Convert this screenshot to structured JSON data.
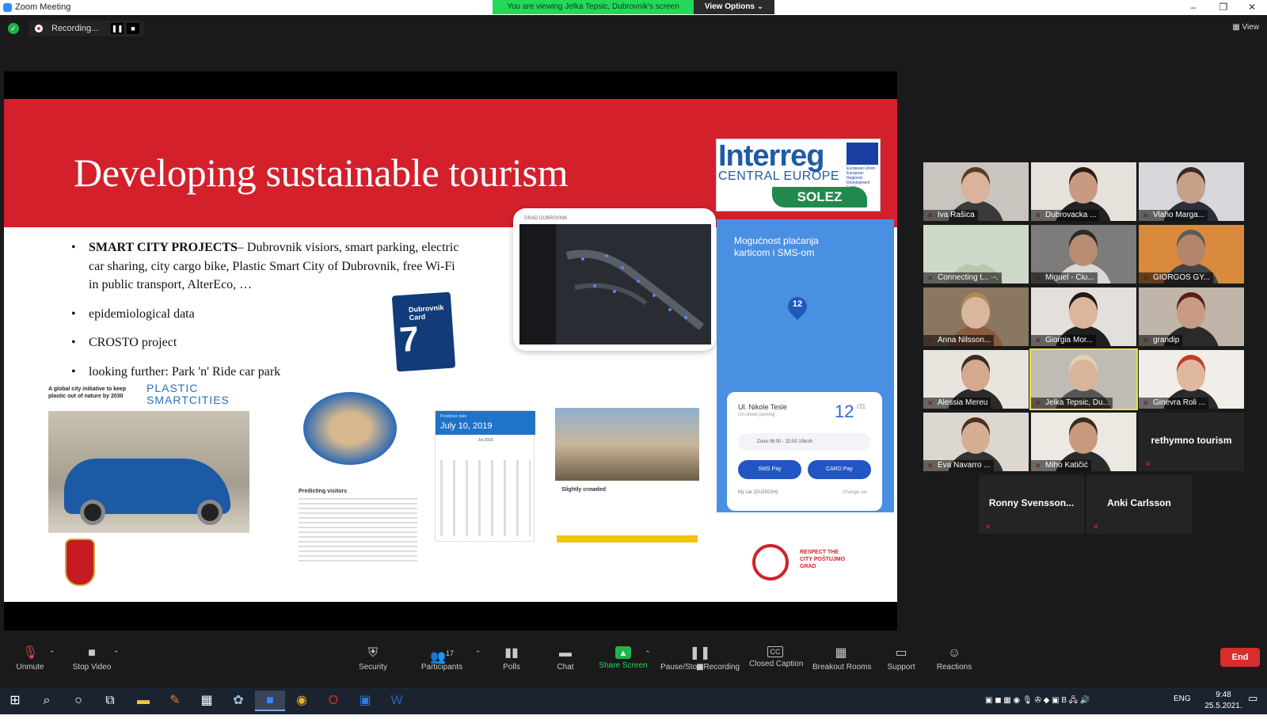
{
  "window": {
    "title": "Zoom Meeting",
    "share_banner": "You are viewing Jelka Tepsic, Dubrovnik's screen",
    "view_options": "View Options ⌄",
    "minimize": "–",
    "restore": "❐",
    "close": "✕"
  },
  "topbar": {
    "recording": "Recording...",
    "pause": "❚❚",
    "stop": "■",
    "view": "View"
  },
  "slide": {
    "title": "Developing sustainable tourism",
    "interreg_big": "Interreg",
    "interreg_ce": "CENTRAL EUROPE",
    "eu_text": "European Union European Regional Development Fund",
    "solez": "SOLEZ",
    "bullets": [
      {
        "bold": "SMART CITY PROJECTS",
        "text": "– Dubrovnik visiors, smart parking, electric car sharing, city cargo bike, Plastic Smart City of Dubrovnik, free Wi-Fi in public transport,  AlterEco, …"
      },
      {
        "bold": "",
        "text": "epidemiological data"
      },
      {
        "bold": "",
        "text": "CROSTO project"
      },
      {
        "bold": "",
        "text": "looking further: Park 'n' Ride car park"
      }
    ],
    "map_label": "GRAD DUBROVNIK",
    "phone_title": "Mogućnost plaćanja karticom i SMS-om",
    "pin_number": "12",
    "street": "Ul. Nikole Tesle",
    "street_sub": "On-street parking",
    "spaces": "12",
    "spaces_total": "/31",
    "zone": "Zone      06:00 - 22:00      10kn/h",
    "sms_pay": "SMS Pay",
    "card_pay": "CARD Pay",
    "my_car": "My car  (DU555SH)",
    "change_car": "Change car",
    "plastic_left": "A global city initiative to keep plastic out of nature by 2030",
    "plastic_right_1": "PLASTIC",
    "plastic_right_2": "SMARTCITIES",
    "dub_card_title": "Dubrovnik Card",
    "dub_card_num": "7",
    "visitors_title": "Predicting visitors",
    "calendar_small": "Prediction date",
    "calendar_date": "July 10, 2019",
    "calendar_month": "Jul 2019",
    "crowded": "Slightly crowded",
    "respect": "RESPECT THE CITY POŠTUJMO GRAD"
  },
  "participants": [
    {
      "name": "Iva Rašica",
      "bg": "#c9c4bd",
      "skin": "#d9b39a",
      "shirt": "#3a3a3a",
      "hair": "#5a3b28"
    },
    {
      "name": "Dubrovacka ...",
      "bg": "#e6e1da",
      "skin": "#c89a82",
      "shirt": "#222",
      "hair": "#2a1d15"
    },
    {
      "name": "Vlaho Marga...",
      "bg": "#d6d8dc",
      "skin": "#c7a089",
      "shirt": "#2b2f3a",
      "hair": "#3a2a20"
    },
    {
      "name": "Connecting t... ·-.",
      "bg": "#cfd9c8",
      "skin": "#cfd9c8",
      "shirt": "#b8c6ad",
      "hair": "#cfd9c8"
    },
    {
      "name": "Miguel - Ciu...",
      "bg": "#7d7c7a",
      "skin": "#b88d72",
      "shirt": "#d8d8d8",
      "hair": "#2a2a2a"
    },
    {
      "name": "GIORGOS GY...",
      "bg": "#d98a3c",
      "skin": "#b4856a",
      "shirt": "#444",
      "hair": "#5a5a5a"
    },
    {
      "name": "Anna Nilsson...",
      "bg": "#8a7760",
      "skin": "#d9b79e",
      "shirt": "#8a5a3a",
      "hair": "#b08858"
    },
    {
      "name": "Giorgia Mor...",
      "bg": "#e3e0db",
      "skin": "#dcb59c",
      "shirt": "#1f1f1f",
      "hair": "#1f1a17"
    },
    {
      "name": "grandip",
      "bg": "#bfb5a8",
      "skin": "#c99a84",
      "shirt": "#2a2a2a",
      "hair": "#5a1c14"
    },
    {
      "name": "Alessia Mereu",
      "bg": "#e8e4de",
      "skin": "#d4a98e",
      "shirt": "#2a2a2a",
      "hair": "#3a2a1e"
    },
    {
      "name": "Jelka Tepsic, Du...",
      "bg": "#bfbcb6",
      "skin": "#d9b49c",
      "shirt": "#555",
      "hair": "#e2d3b0"
    },
    {
      "name": "Ginevra Roli ...",
      "bg": "#f1ede8",
      "skin": "#e0b8a0",
      "shirt": "#2b2b2b",
      "hair": "#c23b22"
    },
    {
      "name": "Eva Navarro ...",
      "bg": "#dcd7cf",
      "skin": "#d6ae94",
      "shirt": "#333",
      "hair": "#4a3020"
    },
    {
      "name": "Miho Katičić",
      "bg": "#ece8e2",
      "skin": "#c9997e",
      "shirt": "#2a2a2a",
      "hair": "#3a2a20"
    }
  ],
  "nocam_participants": [
    {
      "name": "rethymno tourism"
    },
    {
      "name": "Ronny  Svensson..."
    },
    {
      "name": "Anki Carlsson"
    }
  ],
  "toolbar": {
    "unmute": "Unmute",
    "stop_video": "Stop Video",
    "security": "Security",
    "participants": "Participants",
    "participants_count": "17",
    "polls": "Polls",
    "chat": "Chat",
    "share_screen": "Share Screen",
    "pause_stop_recording": "Pause/Stop Recording",
    "closed_caption": "Closed Caption",
    "breakout_rooms": "Breakout Rooms",
    "support": "Support",
    "reactions": "Reactions",
    "end": "End"
  },
  "taskbar": {
    "language": "ENG",
    "time": "9:48",
    "date": "25.5.2021."
  },
  "colors": {
    "slide_red": "#d3202b",
    "zoom_green": "#22b24c",
    "end_red": "#d62d2d",
    "active_speaker": "#e8e53c"
  }
}
